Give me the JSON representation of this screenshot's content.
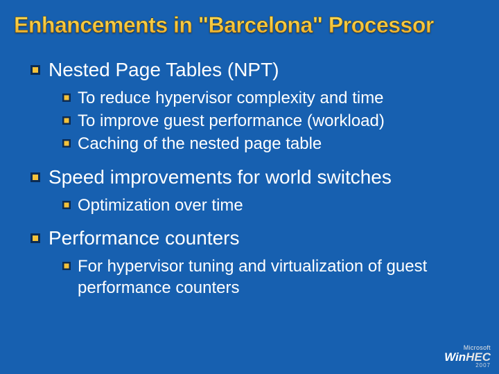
{
  "title": "Enhancements in \"Barcelona\" Processor",
  "bullets": [
    {
      "text": "Nested Page Tables (NPT)",
      "children": [
        "To reduce hypervisor complexity and time",
        "To improve guest performance (workload)",
        "Caching of the nested page table"
      ]
    },
    {
      "text": "Speed improvements for world switches",
      "children": [
        "Optimization over time"
      ]
    },
    {
      "text": "Performance counters",
      "children": [
        "For hypervisor tuning and virtualization of guest performance counters"
      ]
    }
  ],
  "logo": {
    "ms": "Microsoft",
    "main_win": "Win",
    "main_hec": "HEC",
    "year": "2007"
  }
}
